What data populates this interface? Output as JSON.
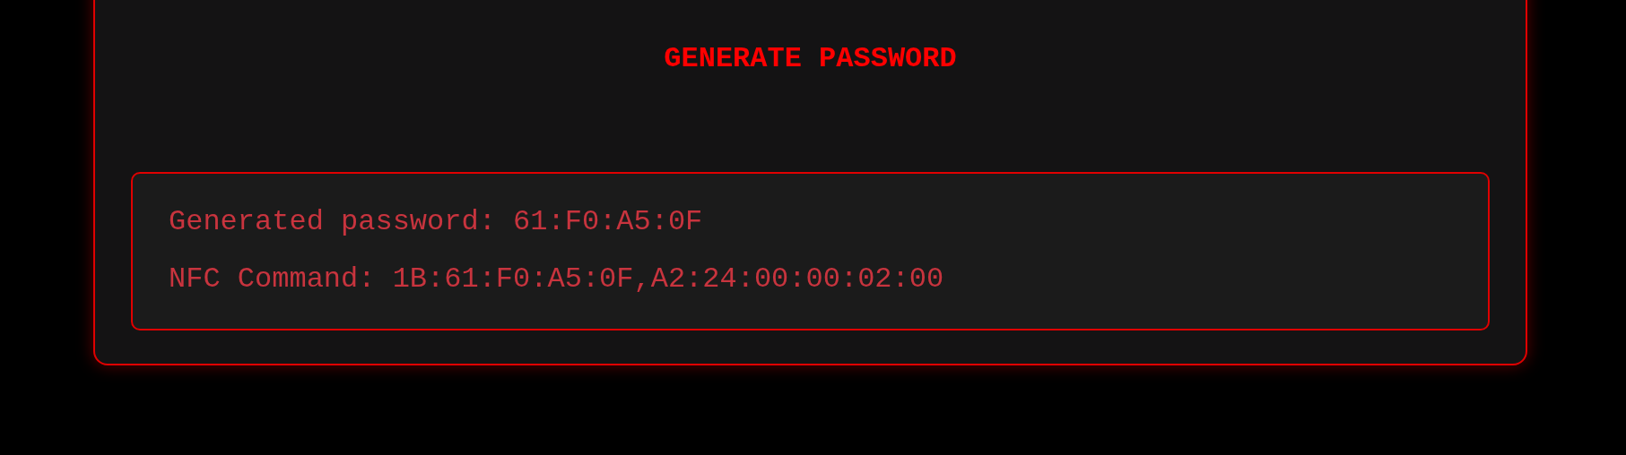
{
  "generate_button": {
    "label": "GENERATE PASSWORD"
  },
  "output": {
    "lines": [
      "Generated password: 61:F0:A5:0F",
      "NFC Command: 1B:61:F0:A5:0F,A2:24:00:00:02:00"
    ]
  }
}
